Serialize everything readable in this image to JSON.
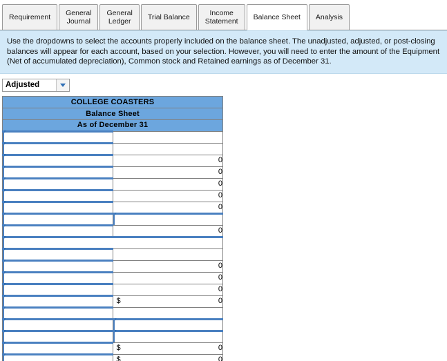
{
  "tabs": [
    {
      "label": "Requirement",
      "active": false
    },
    {
      "label": "General\nJournal",
      "active": false
    },
    {
      "label": "General\nLedger",
      "active": false
    },
    {
      "label": "Trial Balance",
      "active": false
    },
    {
      "label": "Income\nStatement",
      "active": false
    },
    {
      "label": "Balance Sheet",
      "active": true
    },
    {
      "label": "Analysis",
      "active": false
    }
  ],
  "banner": {
    "text": "Use the dropdowns to select the accounts properly included on the balance sheet. The unadjusted, adjusted, or post-closing balances will appear for each account, based on your selection. However, you will need to enter the amount of the Equipment (Net of accumulated depreciation), Common stock and Retained earnings as of December 31."
  },
  "basis_select": {
    "value": "Adjusted",
    "caret": "chevron-down-icon"
  },
  "sheet": {
    "title_lines": [
      "COLLEGE COASTERS",
      "Balance Sheet",
      "As of December 31"
    ],
    "rows": [
      {
        "account": "",
        "account_type": "dropdown",
        "value": "",
        "currency": "",
        "value_type": "none",
        "rule": "none",
        "span": false
      },
      {
        "account": "",
        "account_type": "dropdown",
        "value": "",
        "currency": "",
        "value_type": "blank",
        "rule": "none",
        "span": false
      },
      {
        "account": "",
        "account_type": "dropdown",
        "value": "0",
        "currency": "",
        "value_type": "amount",
        "rule": "none",
        "span": false
      },
      {
        "account": "",
        "account_type": "dropdown",
        "value": "0",
        "currency": "",
        "value_type": "amount",
        "rule": "none",
        "span": false
      },
      {
        "account": "",
        "account_type": "dropdown",
        "value": "0",
        "currency": "",
        "value_type": "amount",
        "rule": "none",
        "span": false
      },
      {
        "account": "",
        "account_type": "dropdown",
        "value": "0",
        "currency": "",
        "value_type": "amount",
        "rule": "none",
        "span": false
      },
      {
        "account": "",
        "account_type": "dropdown",
        "value": "0",
        "currency": "",
        "value_type": "amount",
        "rule": "top",
        "span": false
      },
      {
        "account": "",
        "account_type": "dropdown",
        "value": "",
        "currency": "",
        "value_type": "dropdown",
        "rule": "none",
        "span": false
      },
      {
        "account": "",
        "account_type": "dropdown",
        "value": "0",
        "currency": "",
        "value_type": "amount",
        "rule": "bottom",
        "span": false
      },
      {
        "account": "",
        "account_type": "dropdown",
        "value": "",
        "currency": "",
        "value_type": "none",
        "rule": "none",
        "span": true
      },
      {
        "account": "",
        "account_type": "dropdown",
        "value": "",
        "currency": "",
        "value_type": "blank",
        "rule": "none",
        "span": false
      },
      {
        "account": "",
        "account_type": "dropdown",
        "value": "0",
        "currency": "",
        "value_type": "amount",
        "rule": "none",
        "span": false
      },
      {
        "account": "",
        "account_type": "dropdown",
        "value": "0",
        "currency": "",
        "value_type": "amount",
        "rule": "none",
        "span": false
      },
      {
        "account": "",
        "account_type": "dropdown",
        "value": "0",
        "currency": "",
        "value_type": "amount",
        "rule": "none",
        "span": false
      },
      {
        "account": "",
        "account_type": "dropdown",
        "value": "0",
        "currency": "$",
        "value_type": "amount",
        "rule": "top",
        "span": false
      },
      {
        "account": "",
        "account_type": "dropdown",
        "value": "",
        "currency": "",
        "value_type": "blank",
        "rule": "none",
        "span": false
      },
      {
        "account": "",
        "account_type": "dropdown",
        "value": "",
        "currency": "",
        "value_type": "dropdown",
        "rule": "none",
        "span": false
      },
      {
        "account": "",
        "account_type": "dropdown",
        "value": "",
        "currency": "",
        "value_type": "dropdown",
        "rule": "none",
        "span": false
      },
      {
        "account": "",
        "account_type": "dropdown",
        "value": "0",
        "currency": "$",
        "value_type": "amount",
        "rule": "top",
        "span": false
      },
      {
        "account": "",
        "account_type": "dropdown",
        "value": "0",
        "currency": "$",
        "value_type": "amount",
        "rule": "bottom",
        "span": false
      }
    ]
  },
  "colors": {
    "header_blue": "#6ca6de",
    "banner_blue": "#d3e9f8",
    "dropdown_rule": "#4a80c0",
    "caret": "#2f6fb5"
  }
}
